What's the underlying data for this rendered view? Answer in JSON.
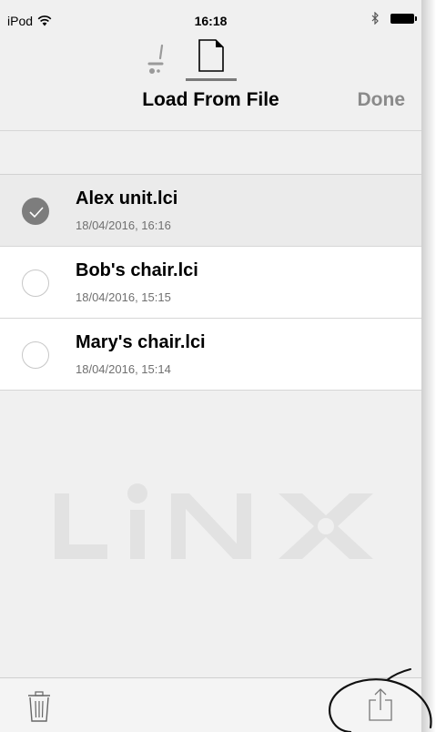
{
  "status_bar": {
    "carrier": "iPod",
    "time": "16:18",
    "icons": [
      "wifi-icon",
      "bluetooth-icon",
      "battery-icon"
    ]
  },
  "tabs": [
    {
      "icon": "wheelchair-icon",
      "selected": false
    },
    {
      "icon": "document-icon",
      "selected": true
    }
  ],
  "nav": {
    "title": "Load From File",
    "done_label": "Done"
  },
  "files": [
    {
      "name": "Alex unit.lci",
      "date": "18/04/2016, 16:16",
      "selected": true
    },
    {
      "name": "Bob's chair.lci",
      "date": "18/04/2016, 15:15",
      "selected": false
    },
    {
      "name": "Mary's chair.lci",
      "date": "18/04/2016, 15:14",
      "selected": false
    }
  ],
  "watermark": {
    "text": "LINX"
  },
  "toolbar": {
    "left_icon": "trash-icon",
    "right_icon": "share-icon"
  },
  "colors": {
    "background": "#f0f0f0",
    "selected_row": "#ebebeb",
    "check": "#7d7d7d",
    "done_text": "#8a8a8a",
    "watermark": "#e2e2e2"
  }
}
